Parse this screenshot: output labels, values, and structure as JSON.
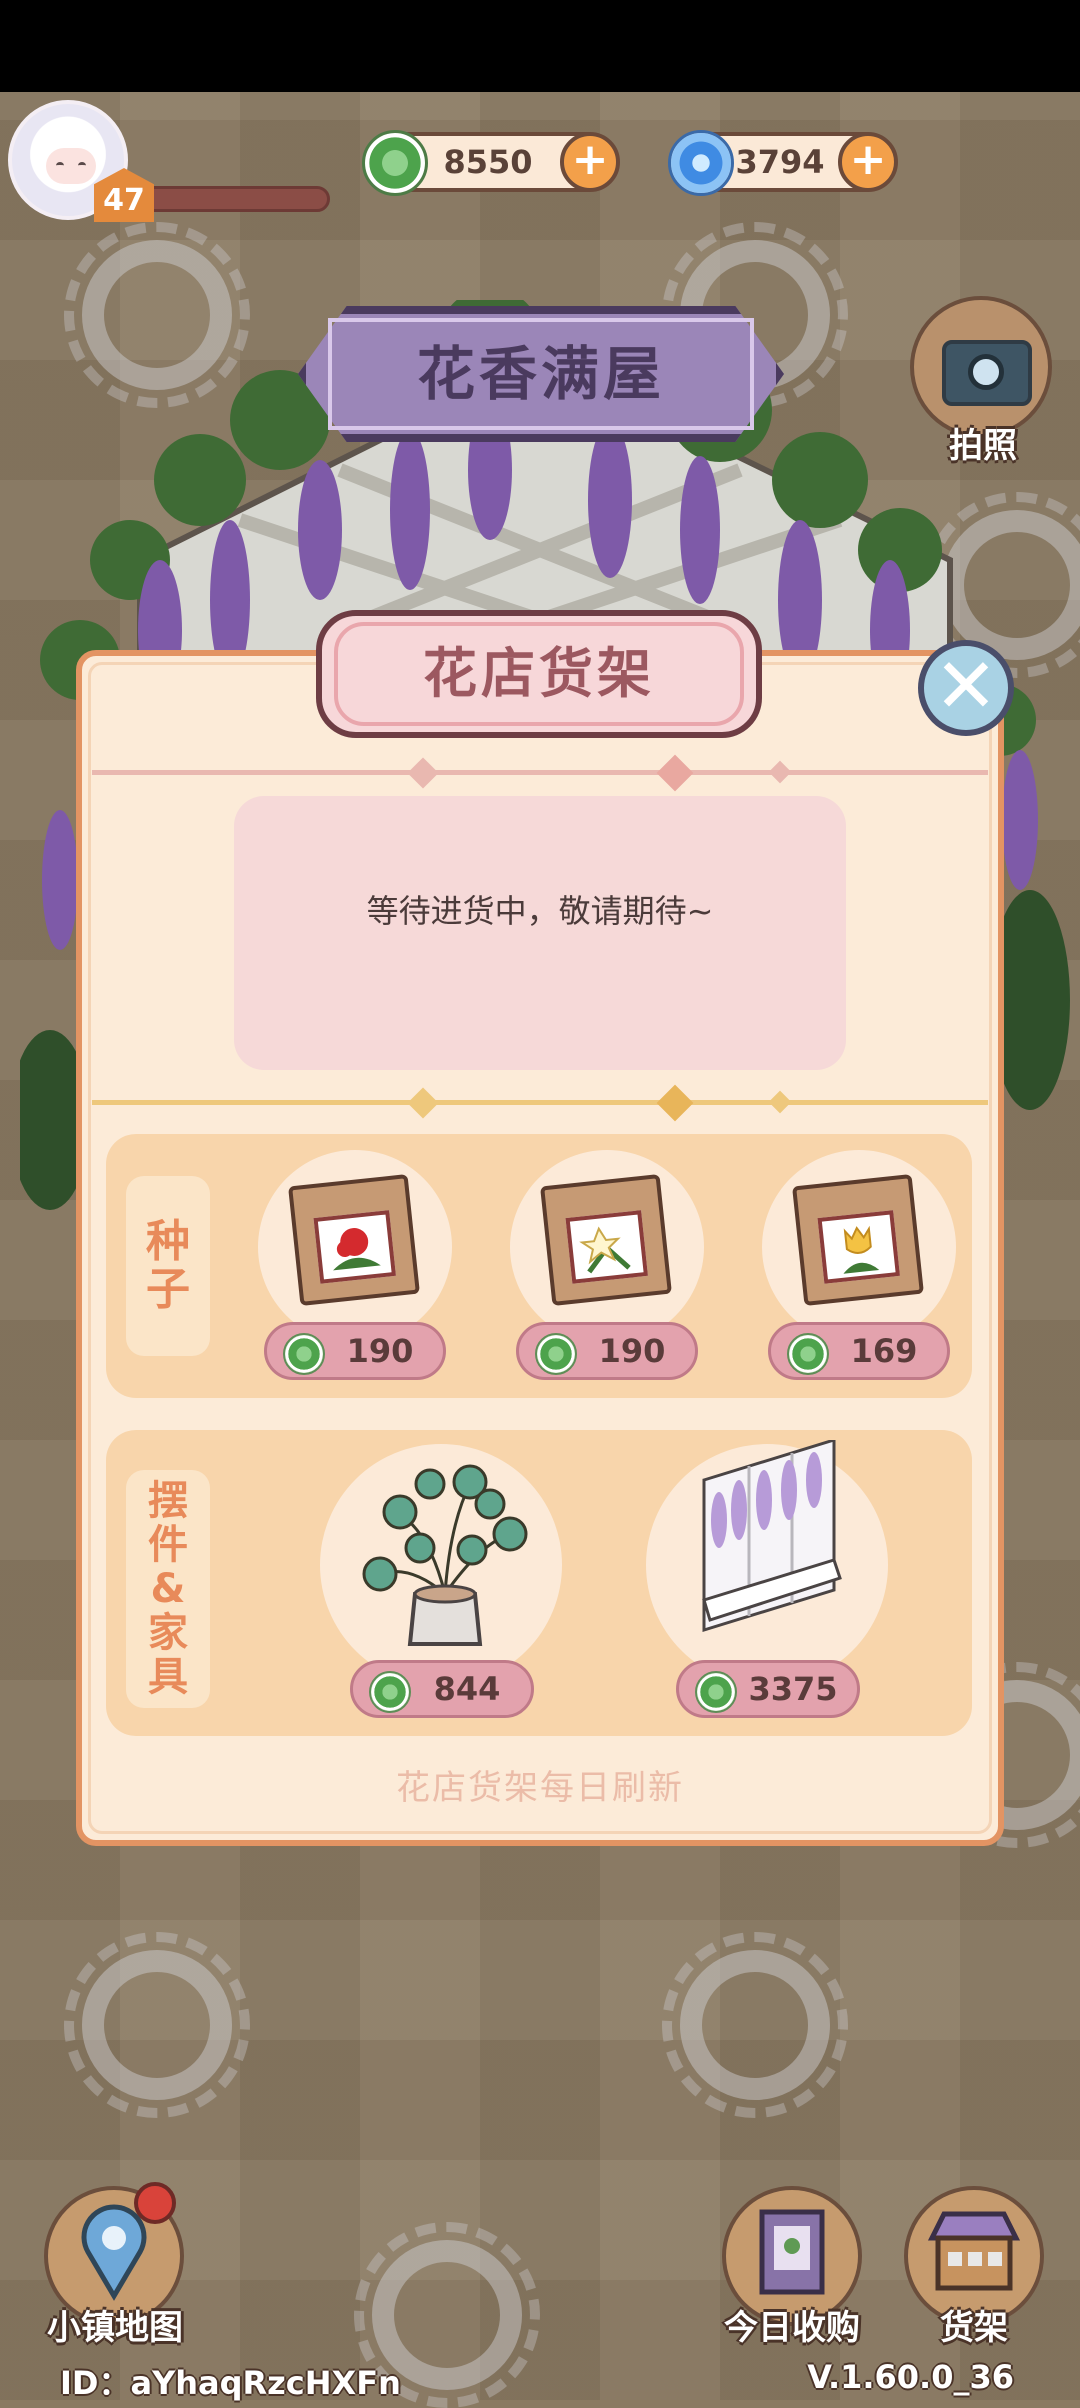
{
  "hud": {
    "level": "47",
    "xp_fraction": 0.0,
    "clover_currency": "8550",
    "swirl_currency": "3794",
    "camera_label": "拍照"
  },
  "area_banner": {
    "title": "花香满屋"
  },
  "shop_modal": {
    "title": "花店货架",
    "notice": "等待进货中，敬请期待~",
    "footer_note": "花店货架每日刷新",
    "seeds": {
      "label_chars": [
        "种",
        "子"
      ],
      "items": [
        {
          "name": "red-flower-seed",
          "price": "190",
          "flower_color": "#d42a2e"
        },
        {
          "name": "white-flower-seed",
          "price": "190",
          "flower_color": "#f3f0dc"
        },
        {
          "name": "yellow-tulip-seed",
          "price": "169",
          "flower_color": "#f4c243"
        }
      ]
    },
    "furniture": {
      "label_chars": [
        "摆",
        "件",
        "&",
        "家",
        "具"
      ],
      "items": [
        {
          "name": "potted-plant",
          "price": "844"
        },
        {
          "name": "wisteria-window",
          "price": "3375"
        }
      ]
    }
  },
  "bottom_nav": {
    "map_label": "小镇地图",
    "daily_label": "今日收购",
    "shelf_label": "货架"
  },
  "footer": {
    "id_text": "ID：aYhaqRzcHXFn",
    "version": "V.1.60.0_36"
  },
  "colors": {
    "modal_bg": "#fcebd8",
    "modal_border": "#e39463",
    "section_bg": "#f8d5ab",
    "price_pill": "#e3a2ad",
    "banner_purple": "#9b86b8"
  }
}
